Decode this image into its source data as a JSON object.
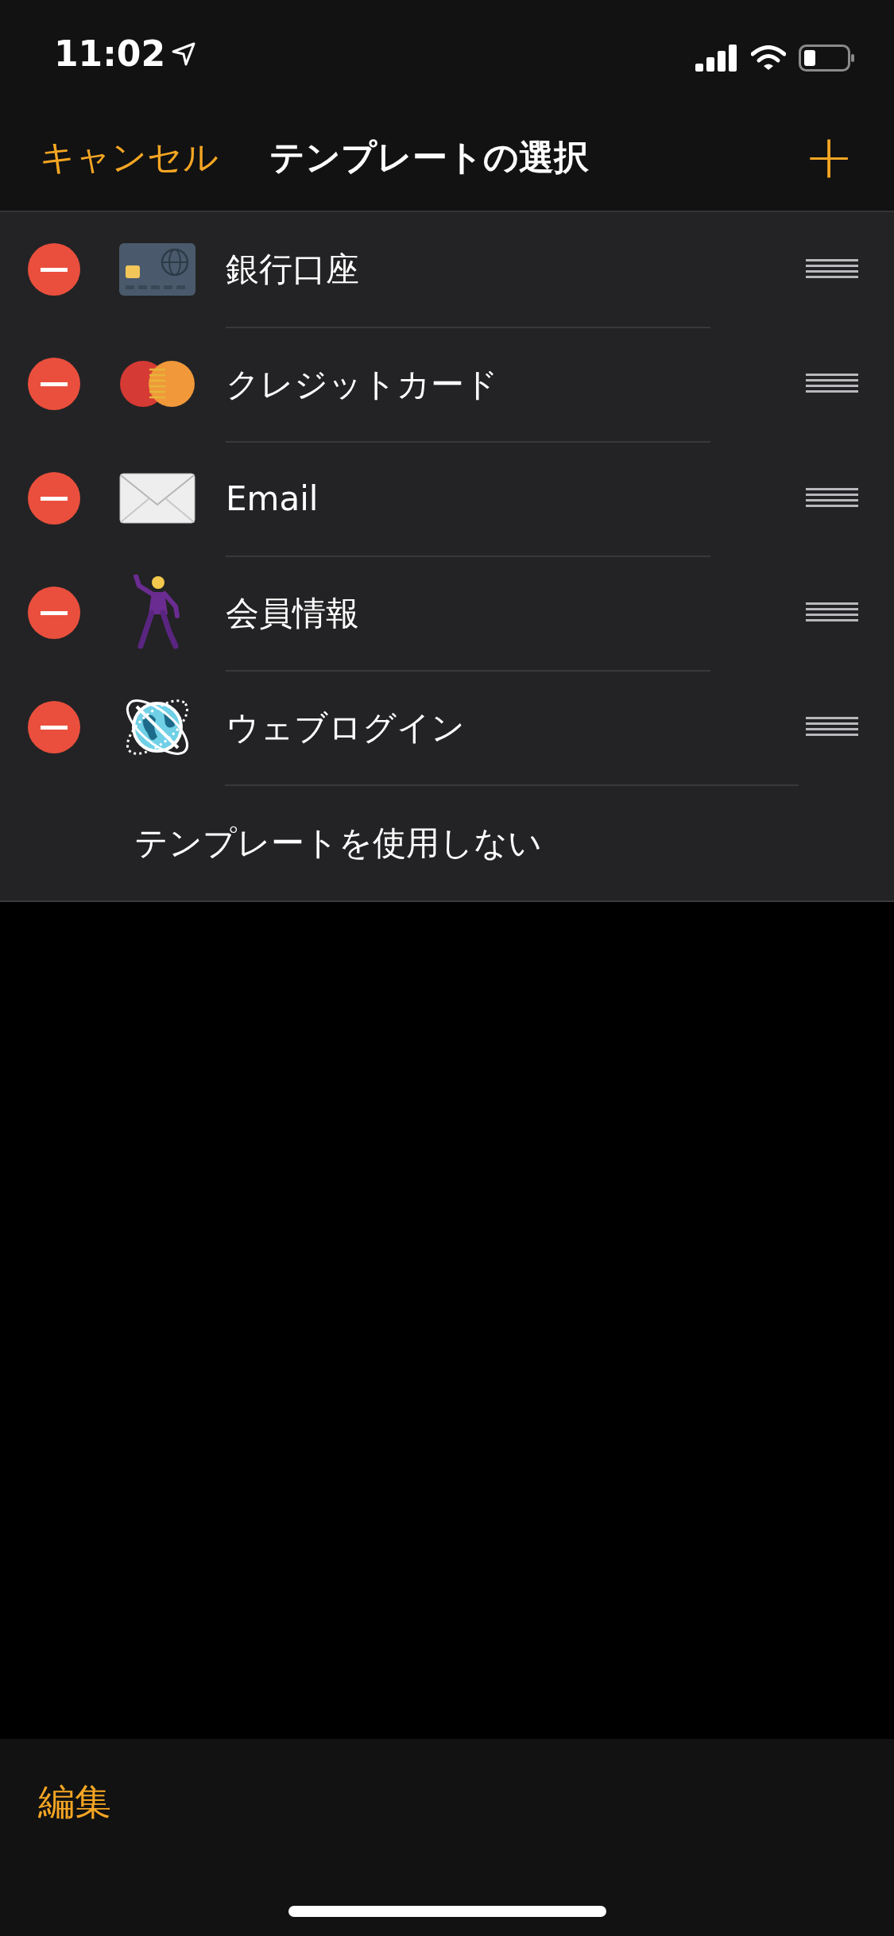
{
  "status_bar": {
    "time": "11:02"
  },
  "nav": {
    "cancel": "キャンセル",
    "title": "テンプレートの選択",
    "add": "+"
  },
  "templates": [
    {
      "kind": "bank-card",
      "label": "銀行口座"
    },
    {
      "kind": "credit-card",
      "label": "クレジットカード"
    },
    {
      "kind": "envelope",
      "label": "Email"
    },
    {
      "kind": "dancer",
      "label": "会員情報"
    },
    {
      "kind": "globe",
      "label": "ウェブログイン"
    }
  ],
  "no_template": "テンプレートを使用しない",
  "toolbar": {
    "edit": "編集"
  }
}
